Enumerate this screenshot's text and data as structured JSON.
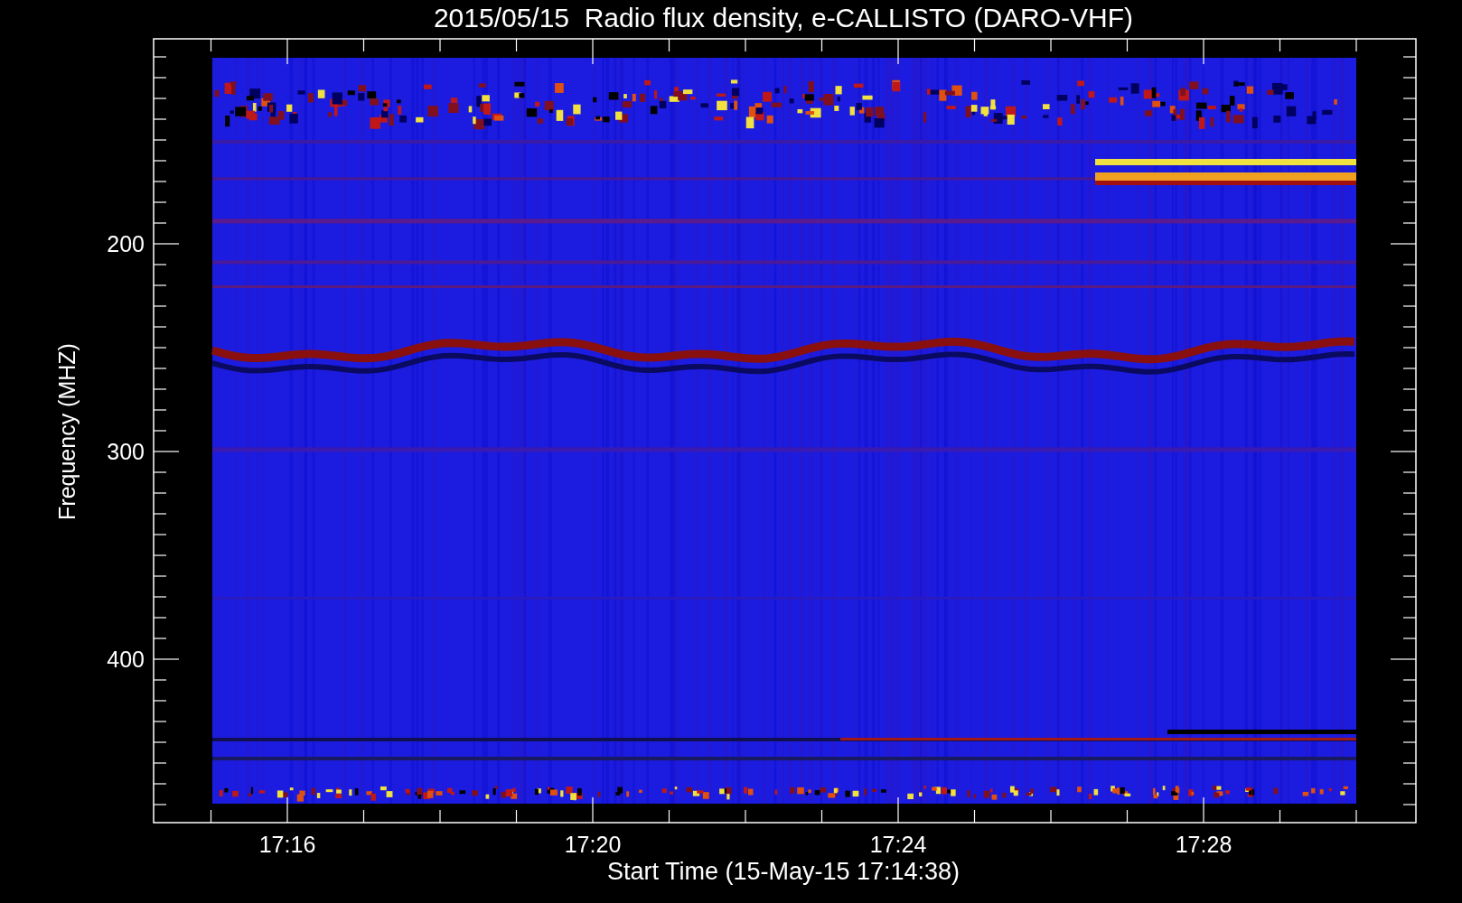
{
  "title": "2015/05/15  Radio flux density, e-CALLISTO (DARO-VHF)",
  "y_axis": {
    "title": "Frequency (MHZ)",
    "tick_labels": [
      "200",
      "300",
      "400"
    ]
  },
  "x_axis": {
    "title": "Start Time (15-May-15 17:14:38)",
    "tick_labels": [
      "17:16",
      "17:20",
      "17:24",
      "17:28"
    ]
  }
}
